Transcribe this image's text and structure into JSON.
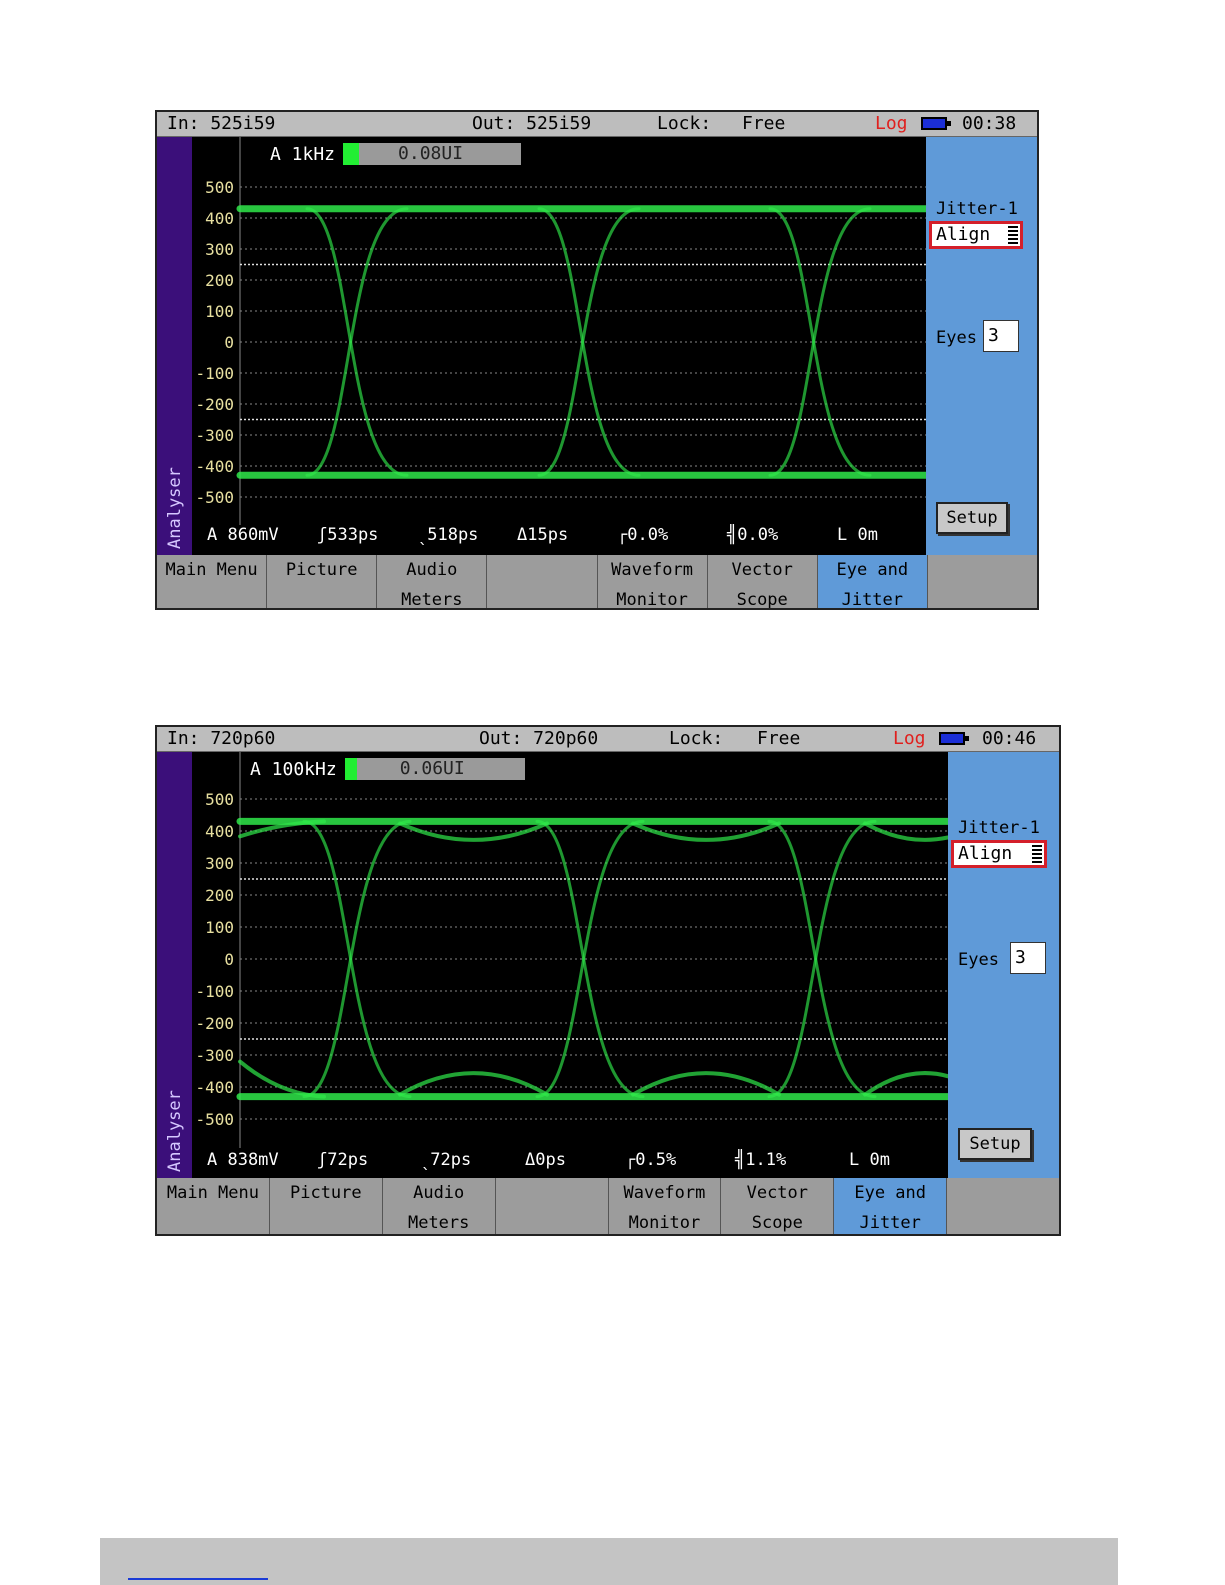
{
  "screens": [
    {
      "status": {
        "input": "In: 525i59",
        "output": "Out: 525i59",
        "lock_label": "Lock:",
        "lock_value": "Free",
        "log": "Log",
        "time": "00:38"
      },
      "side_label": "Analyser",
      "scope": {
        "name": "A 1kHz",
        "meter_text": "0.08UI",
        "meter_level": 0.08
      },
      "y_ticks": [
        "500",
        "400",
        "300",
        "200",
        "100",
        "0",
        "-100",
        "-200",
        "-300",
        "-400",
        "-500"
      ],
      "measurements": [
        "A 860mV",
        "ʃ533ps",
        "ˎ518ps",
        "Δ15ps",
        "┌0.0%",
        "╣0.0%",
        "L 0m"
      ],
      "panel": {
        "jitter_label": "Jitter-1",
        "align_value": "Align",
        "eyes_label": "Eyes",
        "eyes_value": "3",
        "setup_label": "Setup"
      },
      "tabs": [
        {
          "line1": "Main Menu",
          "line2": ""
        },
        {
          "line1": "Picture",
          "line2": ""
        },
        {
          "line1": "Audio",
          "line2": "Meters"
        },
        {
          "line1": "",
          "line2": ""
        },
        {
          "line1": "Waveform",
          "line2": "Monitor"
        },
        {
          "line1": "Vector",
          "line2": "Scope"
        },
        {
          "line1": "Eye and",
          "line2": "Jitter"
        },
        {
          "line1": "",
          "line2": ""
        }
      ]
    },
    {
      "status": {
        "input": "In: 720p60",
        "output": "Out: 720p60",
        "lock_label": "Lock:",
        "lock_value": "Free",
        "log": "Log",
        "time": "00:46"
      },
      "side_label": "Analyser",
      "scope": {
        "name": "A 100kHz",
        "meter_text": "0.06UI",
        "meter_level": 0.06
      },
      "y_ticks": [
        "500",
        "400",
        "300",
        "200",
        "100",
        "0",
        "-100",
        "-200",
        "-300",
        "-400",
        "-500"
      ],
      "measurements": [
        "A 838mV",
        "ʃ72ps",
        "ˎ72ps",
        "Δ0ps",
        "┌0.5%",
        "╣1.1%",
        "L 0m"
      ],
      "panel": {
        "jitter_label": "Jitter-1",
        "align_value": "Align",
        "eyes_label": "Eyes",
        "eyes_value": "3",
        "setup_label": "Setup"
      },
      "tabs": [
        {
          "line1": "Main Menu",
          "line2": ""
        },
        {
          "line1": "Picture",
          "line2": ""
        },
        {
          "line1": "Audio",
          "line2": "Meters"
        },
        {
          "line1": "",
          "line2": ""
        },
        {
          "line1": "Waveform",
          "line2": "Monitor"
        },
        {
          "line1": "Vector",
          "line2": "Scope"
        },
        {
          "line1": "Eye and",
          "line2": "Jitter"
        },
        {
          "line1": "",
          "line2": ""
        }
      ]
    }
  ],
  "colors": {
    "trace": "#2fe84a",
    "tick_text": "#e8e0a0",
    "accent_panel": "#5f9ad8",
    "side_label_bg": "#3b0f7a",
    "log_red": "#e0201e"
  }
}
